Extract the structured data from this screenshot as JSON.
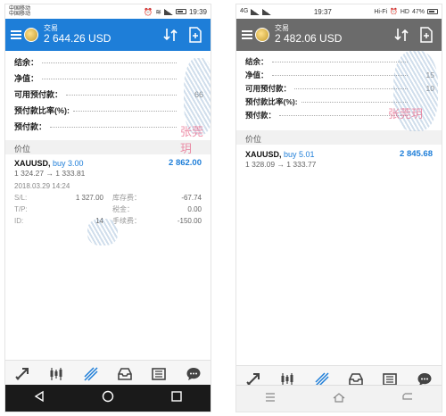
{
  "left": {
    "status": {
      "carrier_line1": "中国移动",
      "carrier_line2": "中国移动",
      "time": "19:39"
    },
    "appbar": {
      "title": "交易",
      "balance": "2 644.26 USD"
    },
    "summary": [
      {
        "label": "结余："
      },
      {
        "label": "净值："
      },
      {
        "label": "可用预付款：",
        "value": "66"
      },
      {
        "label": "预付款比率(%):"
      },
      {
        "label": "预付款："
      }
    ],
    "section_title": "价位",
    "order": {
      "symbol": "XAUUSD,",
      "direction": "buy 3.00",
      "profit": "2 862.00",
      "prices": "1 324.27 → 1 333.81",
      "open_time": "2018.03.29 14:24",
      "sl_label": "S/L:",
      "sl_value": "1 327.00",
      "tp_label": "T/P:",
      "tp_value": "",
      "id_label": "ID:",
      "id_value": "14",
      "swap_label": "库存费：",
      "swap_value": "-67.74",
      "tax_label": "税金：",
      "tax_value": "0.00",
      "commission_label": "手续费：",
      "commission_value": "-150.00"
    },
    "watermark": "张莞玥"
  },
  "right": {
    "status": {
      "network": "4G",
      "hifi": "Hi-Fi",
      "hd": "HD",
      "battery": "47%",
      "time": "19:37"
    },
    "appbar": {
      "title": "交易",
      "balance": "2 482.06 USD"
    },
    "summary": [
      {
        "label": "结余："
      },
      {
        "label": "净值：",
        "value": "15"
      },
      {
        "label": "可用预付款：",
        "value": "10"
      },
      {
        "label": "预付款比率(%):"
      },
      {
        "label": "预付款："
      }
    ],
    "section_title": "价位",
    "order": {
      "symbol": "XAUUSD,",
      "direction": "buy 5.01",
      "profit": "2 845.68",
      "prices": "1 328.09 → 1 333.77"
    },
    "watermark": "张莞玥"
  },
  "colors": {
    "accent": "#1e7ed8",
    "appbar_right": "#6b6b6b",
    "watermark": "#e86a8c"
  },
  "icons": {
    "appbar": [
      "sort-arrows-icon",
      "new-order-icon"
    ],
    "tabs": [
      "quotes-icon",
      "chart-icon",
      "trade-icon",
      "history-icon",
      "news-icon",
      "chat-icon"
    ],
    "nav_left": [
      "back-icon",
      "home-icon",
      "recents-icon"
    ],
    "nav_right": [
      "menu-icon",
      "home-icon",
      "back-icon"
    ]
  }
}
